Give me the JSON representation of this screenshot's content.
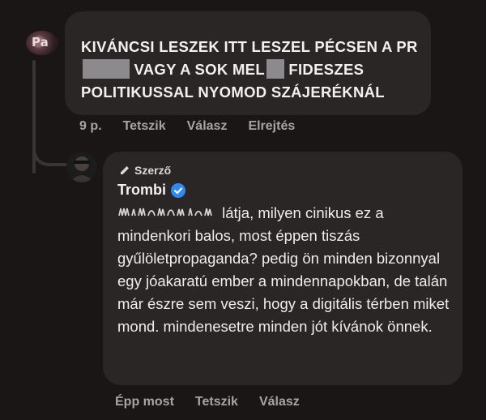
{
  "comment": {
    "avatar_initials": "Pa",
    "text_parts": [
      "KIVÁNCSI LESZEK ITT LESZEL PÉCSEN A PR",
      "VAGY A SOK MEL",
      "FIDESZES POLITIKUSSAL NYOMOD SZÁJERÉKNÁL"
    ],
    "actions": {
      "time": "9 p.",
      "like": "Tetszik",
      "reply": "Válasz",
      "hide": "Elrejtés"
    }
  },
  "reply": {
    "badge": "Szerző",
    "author": "Trombi",
    "text": "látja, milyen cinikus ez a mindenkori balos, most éppen tiszás gyűlöletpropaganda? pedig ön minden bizonnyal egy jóakaratú ember a mindennapokban, de talán már észre sem veszi, hogy a digitális térben miket mond. mindenesetre minden jót kívánok önnek.",
    "actions": {
      "time": "Épp most",
      "like": "Tetszik",
      "reply": "Válasz"
    }
  },
  "colors": {
    "background": "#1a1616",
    "bubble": "#2b2626",
    "verified": "#2e8af0"
  }
}
